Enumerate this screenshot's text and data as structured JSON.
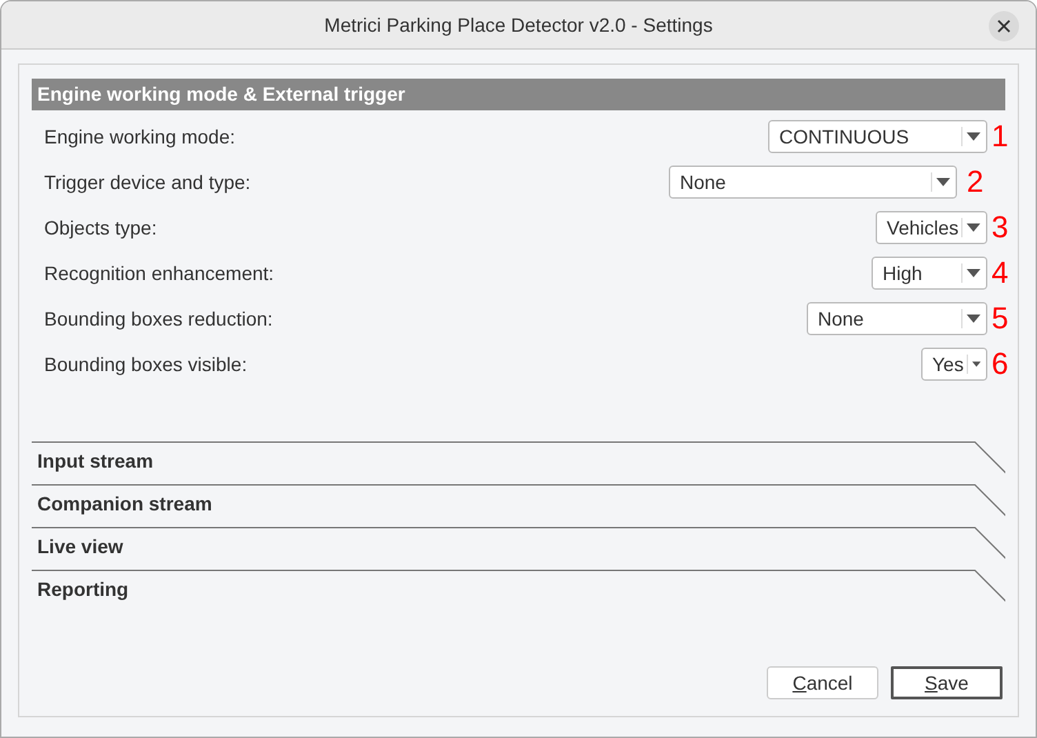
{
  "window": {
    "title": "Metrici Parking Place Detector v2.0 - Settings"
  },
  "section": {
    "title": "Engine working mode & External trigger",
    "settings": [
      {
        "label": "Engine working mode:",
        "value": "CONTINUOUS",
        "number": "1"
      },
      {
        "label": "Trigger device and type:",
        "value": "None",
        "number": "2"
      },
      {
        "label": "Objects type:",
        "value": "Vehicles",
        "number": "3"
      },
      {
        "label": "Recognition enhancement:",
        "value": "High",
        "number": "4"
      },
      {
        "label": "Bounding boxes reduction:",
        "value": "None",
        "number": "5"
      },
      {
        "label": "Bounding boxes visible:",
        "value": "Yes",
        "number": "6"
      }
    ]
  },
  "collapsed_sections": [
    {
      "title": "Input stream",
      "expanded": false
    },
    {
      "title": "Companion stream",
      "expanded": false
    },
    {
      "title": "Live view",
      "expanded": false
    },
    {
      "title": "Reporting",
      "expanded": false
    }
  ],
  "buttons": [
    {
      "label": "Cancel",
      "default": false
    },
    {
      "label": "Save",
      "default": true
    }
  ]
}
